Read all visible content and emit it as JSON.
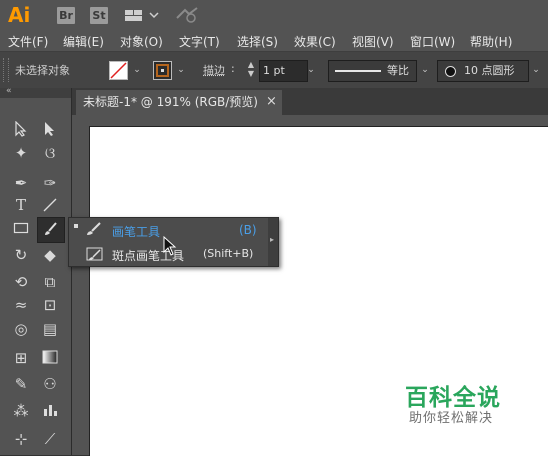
{
  "app": {
    "logo": "Ai",
    "badges": [
      "Br",
      "St"
    ]
  },
  "menu": [
    "文件(F)",
    "编辑(E)",
    "对象(O)",
    "文字(T)",
    "选择(S)",
    "效果(C)",
    "视图(V)",
    "窗口(W)",
    "帮助(H)"
  ],
  "control": {
    "selection_status": "未选择对象",
    "stroke_label": "描边",
    "stroke_value": "1 pt",
    "profile_label": "等比",
    "brush_label": "10 点圆形"
  },
  "doc_tab": {
    "title": "未标题-1* @ 191% (RGB/预览)",
    "close": "×"
  },
  "flyout": {
    "items": [
      {
        "label": "画笔工具",
        "shortcut": "(B)"
      },
      {
        "label": "斑点画笔工具",
        "shortcut": "(Shift+B)"
      }
    ]
  },
  "watermark": {
    "title": "百科全说",
    "subtitle": "助你轻松解决"
  },
  "colors": {
    "accent": "#ff9a00",
    "selected_text": "#4a9fe8",
    "watermark": "#2aa65c"
  }
}
